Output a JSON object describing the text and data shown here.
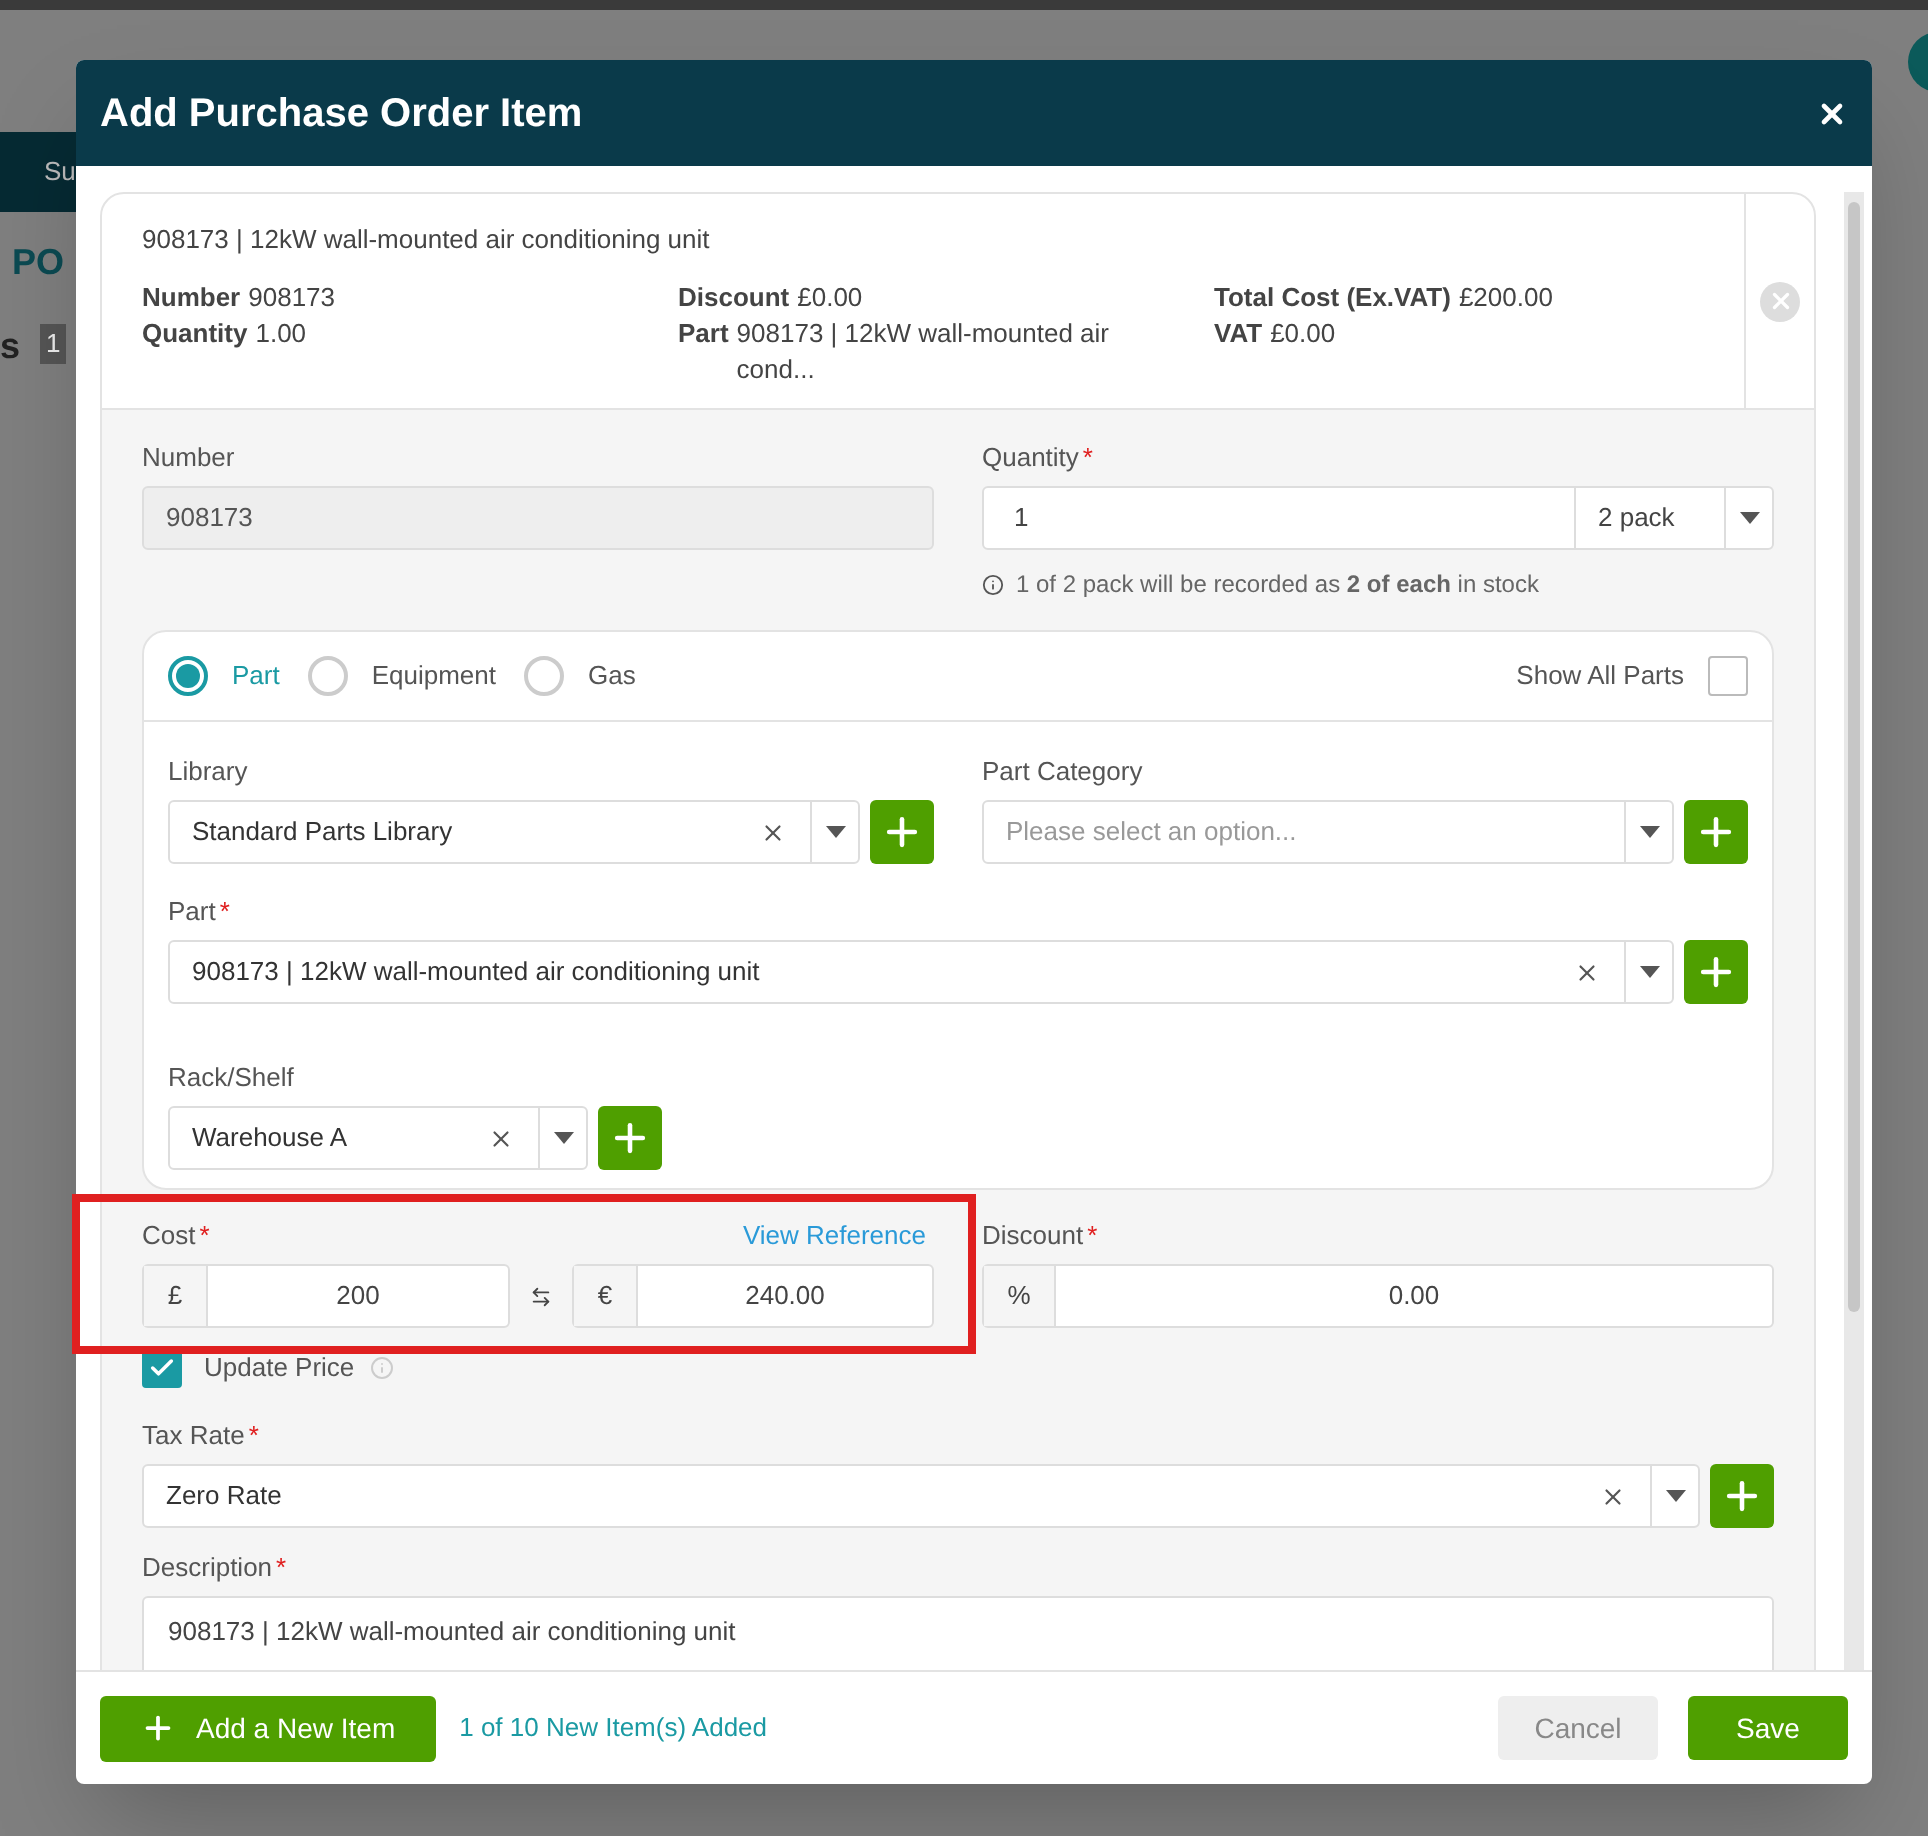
{
  "background_page": {
    "toolbar_label": "Su",
    "heading": "PO",
    "tab_label": "s",
    "badge": "1"
  },
  "dialog": {
    "title": "Add Purchase Order Item"
  },
  "summary": {
    "title": "908173 | 12kW wall-mounted air conditioning unit",
    "columns": [
      [
        {
          "label": "Number",
          "value": "908173"
        },
        {
          "label": "Quantity",
          "value": "1.00"
        }
      ],
      [
        {
          "label": "Discount",
          "value": "£0.00"
        },
        {
          "label": "Part",
          "value": "908173 | 12kW wall-mounted air cond..."
        }
      ],
      [
        {
          "label": "Total Cost (Ex.VAT)",
          "value": "£200.00"
        },
        {
          "label": "VAT",
          "value": "£0.00"
        }
      ]
    ]
  },
  "number": {
    "label": "Number",
    "value": "908173",
    "disabled": true
  },
  "quantity": {
    "label": "Quantity",
    "required_mark": "*",
    "value": "1",
    "unit": "2 pack",
    "hint": "1 of 2 pack will be recorded as **2 of each** in stock"
  },
  "item_type": {
    "options": [
      {
        "label": "Part",
        "selected": true
      },
      {
        "label": "Equipment",
        "selected": false
      },
      {
        "label": "Gas",
        "selected": false
      }
    ],
    "show_all_parts": {
      "label": "Show All Parts",
      "checked": false
    }
  },
  "library": {
    "label": "Library",
    "value": "Standard Parts Library"
  },
  "part_category": {
    "label": "Part Category",
    "placeholder": "Please select an option..."
  },
  "part": {
    "label": "Part",
    "required_mark": "*",
    "value": "908173 | 12kW wall-mounted air conditioning unit"
  },
  "rack_shelf": {
    "label": "Rack/Shelf",
    "value": "Warehouse A"
  },
  "cost": {
    "label": "Cost",
    "required_mark": "*",
    "link": "View Reference",
    "base_symbol": "£",
    "base_value": "200",
    "foreign_symbol": "€",
    "foreign_value": "240.00"
  },
  "discount": {
    "label": "Discount",
    "required_mark": "*",
    "symbol": "%",
    "value": "0.00"
  },
  "update_price": {
    "label": "Update Price",
    "checked": true
  },
  "tax_rate": {
    "label": "Tax Rate",
    "required_mark": "*",
    "value": "Zero Rate"
  },
  "description": {
    "label": "Description",
    "required_mark": "*",
    "value": "908173 | 12kW wall-mounted air conditioning unit"
  },
  "footer": {
    "add_button": "Add a New Item",
    "status": "1 of 10 New Item(s) Added",
    "cancel": "Cancel",
    "save": "Save"
  }
}
